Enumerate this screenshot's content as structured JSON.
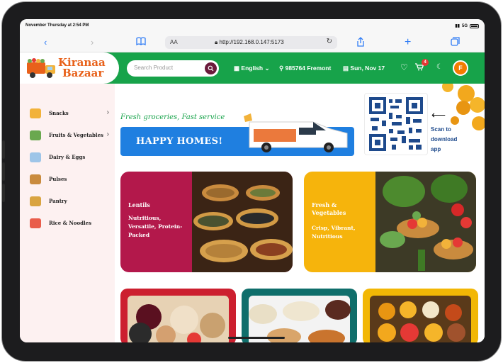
{
  "status": {
    "time": "November Thursday at 2:54 PM",
    "signal": "5G"
  },
  "browser": {
    "text_size_label": "AA",
    "url": "http://192.168.0.147:5173"
  },
  "header": {
    "logo_line1": "Kiranaa",
    "logo_line2": "Bazaar",
    "search_placeholder": "Search Product",
    "language": "English",
    "location": "985764 Fremont",
    "date": "Sun, Nov 17",
    "cart_count": "4",
    "avatar_initial": "F"
  },
  "sidebar": {
    "items": [
      {
        "label": "Snacks",
        "has_submenu": true,
        "icon": "snacks-icon",
        "color": "#f2b23a"
      },
      {
        "label": "Fruits & Vegetables",
        "has_submenu": true,
        "icon": "fruits-vegetables-icon",
        "color": "#6aa84f"
      },
      {
        "label": "Dairy & Eggs",
        "has_submenu": false,
        "icon": "dairy-eggs-icon",
        "color": "#9ec5e8"
      },
      {
        "label": "Pulses",
        "has_submenu": false,
        "icon": "pulses-icon",
        "color": "#c98b3e"
      },
      {
        "label": "Pantry",
        "has_submenu": false,
        "icon": "pantry-icon",
        "color": "#d9a441"
      },
      {
        "label": "Rice & Noodles",
        "has_submenu": false,
        "icon": "rice-noodles-icon",
        "color": "#e95d4b"
      }
    ]
  },
  "hero": {
    "tagline": "Fresh groceries, Fast service",
    "banner_text": "HAPPY HOMES!",
    "scan_lines": [
      "Scan to",
      "download",
      "app"
    ]
  },
  "cards": [
    {
      "title": "Lentils",
      "subtitle_lines": [
        "Nutritious,",
        "Versatile, Protein-",
        "Packed"
      ],
      "bg": "#b3184b"
    },
    {
      "title_lines": [
        "Fresh &",
        "Vegetables"
      ],
      "subtitle_lines": [
        "Crisp, Vibrant,",
        "Nutritious"
      ],
      "bg": "#f6b40c"
    }
  ],
  "tiles": [
    {
      "border": "#cc1f2f"
    },
    {
      "border": "#0f6e6b"
    },
    {
      "border": "#f2b705"
    }
  ],
  "colors": {
    "brand_green": "#17a34a",
    "brand_orange": "#e8611a",
    "link_blue": "#2f7cf6"
  }
}
